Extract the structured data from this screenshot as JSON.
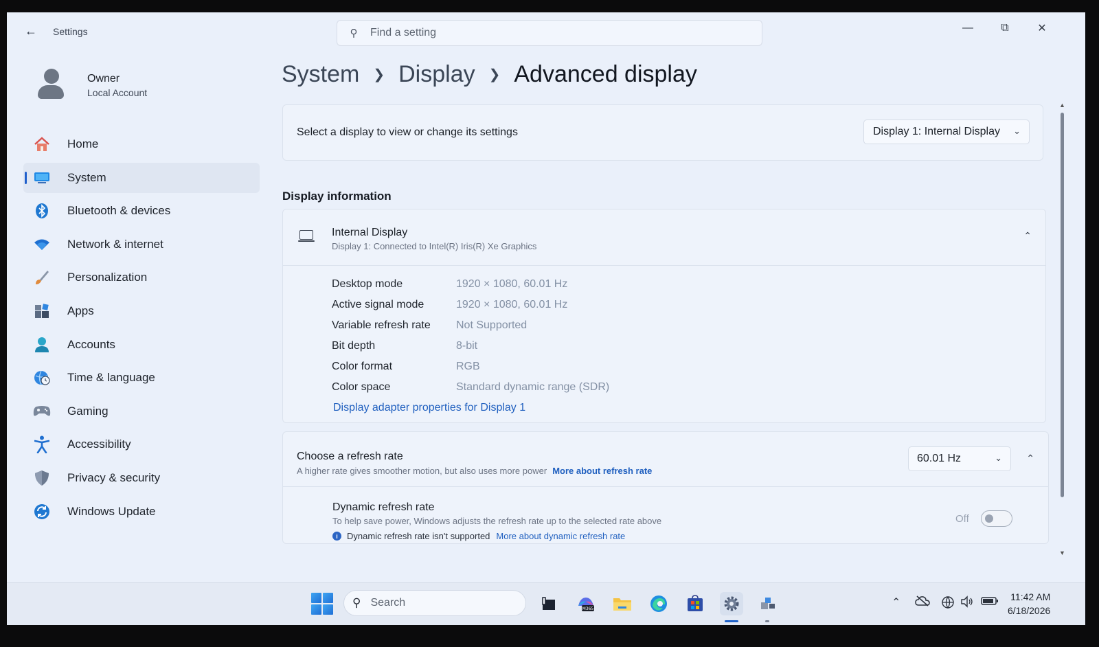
{
  "window": {
    "app_title": "Settings",
    "search_placeholder": "Find a setting"
  },
  "profile": {
    "name": "Owner",
    "account_type": "Local Account"
  },
  "sidebar": {
    "items": [
      {
        "label": "Home",
        "icon": "home-icon"
      },
      {
        "label": "System",
        "icon": "system-icon",
        "active": true
      },
      {
        "label": "Bluetooth & devices",
        "icon": "bluetooth-icon"
      },
      {
        "label": "Network & internet",
        "icon": "wifi-icon"
      },
      {
        "label": "Personalization",
        "icon": "brush-icon"
      },
      {
        "label": "Apps",
        "icon": "apps-icon"
      },
      {
        "label": "Accounts",
        "icon": "accounts-icon"
      },
      {
        "label": "Time & language",
        "icon": "globe-clock-icon"
      },
      {
        "label": "Gaming",
        "icon": "gamepad-icon"
      },
      {
        "label": "Accessibility",
        "icon": "accessibility-icon"
      },
      {
        "label": "Privacy & security",
        "icon": "shield-icon"
      },
      {
        "label": "Windows Update",
        "icon": "update-icon"
      }
    ]
  },
  "breadcrumb": {
    "level1": "System",
    "level2": "Display",
    "current": "Advanced display"
  },
  "display_select": {
    "label": "Select a display to view or change its settings",
    "selected": "Display 1: Internal Display"
  },
  "display_info": {
    "section_title": "Display information",
    "title": "Internal Display",
    "subtitle": "Display 1: Connected to Intel(R) Iris(R) Xe Graphics",
    "rows": [
      {
        "key": "Desktop mode",
        "value": "1920 × 1080, 60.01 Hz"
      },
      {
        "key": "Active signal mode",
        "value": "1920 × 1080, 60.01 Hz"
      },
      {
        "key": "Variable refresh rate",
        "value": "Not Supported"
      },
      {
        "key": "Bit depth",
        "value": "8-bit"
      },
      {
        "key": "Color format",
        "value": "RGB"
      },
      {
        "key": "Color space",
        "value": "Standard dynamic range (SDR)"
      }
    ],
    "adapter_link": "Display adapter properties for Display 1"
  },
  "refresh": {
    "title": "Choose a refresh rate",
    "subtitle": "A higher rate gives smoother motion, but also uses more power",
    "link": "More about refresh rate",
    "selected_rate": "60.01 Hz",
    "dynamic": {
      "title": "Dynamic refresh rate",
      "subtitle": "To help save power, Windows adjusts the refresh rate up to the selected rate above",
      "note": "Dynamic refresh rate isn't supported",
      "link": "More about dynamic refresh rate",
      "state_label": "Off",
      "enabled": false
    }
  },
  "taskbar": {
    "search_label": "Search",
    "time": "11:42 AM",
    "date": "6/18/2026"
  },
  "colors": {
    "accent": "#1f5fcc",
    "link": "#1f5fbf",
    "window_bg": "#eaf0fa"
  }
}
